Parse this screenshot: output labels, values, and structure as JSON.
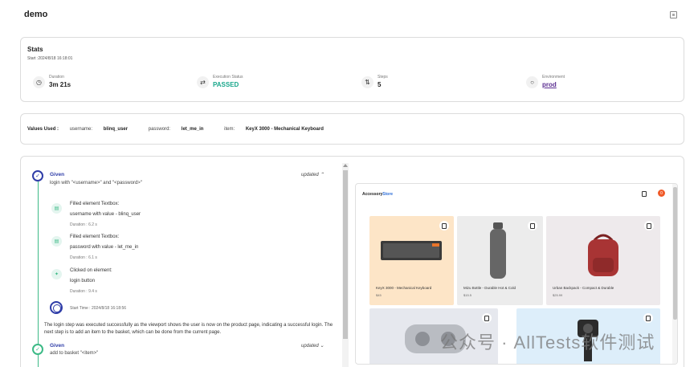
{
  "page": {
    "title": "demo"
  },
  "stats": {
    "title": "Stats",
    "start": "Start :2024/8/18 16:18:01",
    "items": [
      {
        "label": "Duration",
        "value": "3m 21s",
        "icon": "clock-icon"
      },
      {
        "label": "Execution Status",
        "value": "PASSED",
        "icon": "status-arrows-icon"
      },
      {
        "label": "Steps",
        "value": "5",
        "icon": "steps-icon"
      },
      {
        "label": "Environment",
        "value": "prod",
        "icon": "globe-icon"
      }
    ]
  },
  "values_used": {
    "label": "Values Used :",
    "entries": [
      {
        "key": "username:",
        "value": "blinq_user"
      },
      {
        "key": "password:",
        "value": "let_me_in"
      },
      {
        "key": "item:",
        "value": "KeyX 3000 - Mechanical Keyboard"
      }
    ]
  },
  "steps": [
    {
      "keyword": "Given",
      "text": "login with \"<username>\" and \"<password>\"",
      "updated": "updated ⌃",
      "substeps": [
        {
          "line1": "Filled element Textbox:",
          "line2": "username with value - blinq_user",
          "duration": "Duration : 6.2 s"
        },
        {
          "line1": "Filled element Textbox:",
          "line2": "password with value - let_me_in",
          "duration": "Duration : 6.1 s"
        },
        {
          "line1": "Clicked on element:",
          "line2": "login button",
          "duration": "Duration : 9.4 s"
        }
      ],
      "start_time": "Start Time : 2024/8/18 16:18:56",
      "description": "The login step was executed successfully as the viewport shows the user is now on the product page, indicating a successful login. The next step is to add an item to the basket, which can be done from the current page."
    },
    {
      "keyword": "Given",
      "text": "add to basket \"<item>\"",
      "updated": "updated ⌄"
    }
  ],
  "screenshot": {
    "logo_a": "Accessory",
    "logo_b": "Store",
    "badge": "0",
    "products": [
      {
        "name": "KeyX 3000 - Mechanical Keyboard",
        "price": "$45"
      },
      {
        "name": "Mizu Bottle - Durable Hot & Cold",
        "price": "$15.5"
      },
      {
        "name": "Urban Backpack - Compact & Durable",
        "price": "$25.99"
      },
      {
        "name": "",
        "price": ""
      },
      {
        "name": "",
        "price": ""
      }
    ]
  },
  "watermark": "公众号 · AllTests软件测试"
}
